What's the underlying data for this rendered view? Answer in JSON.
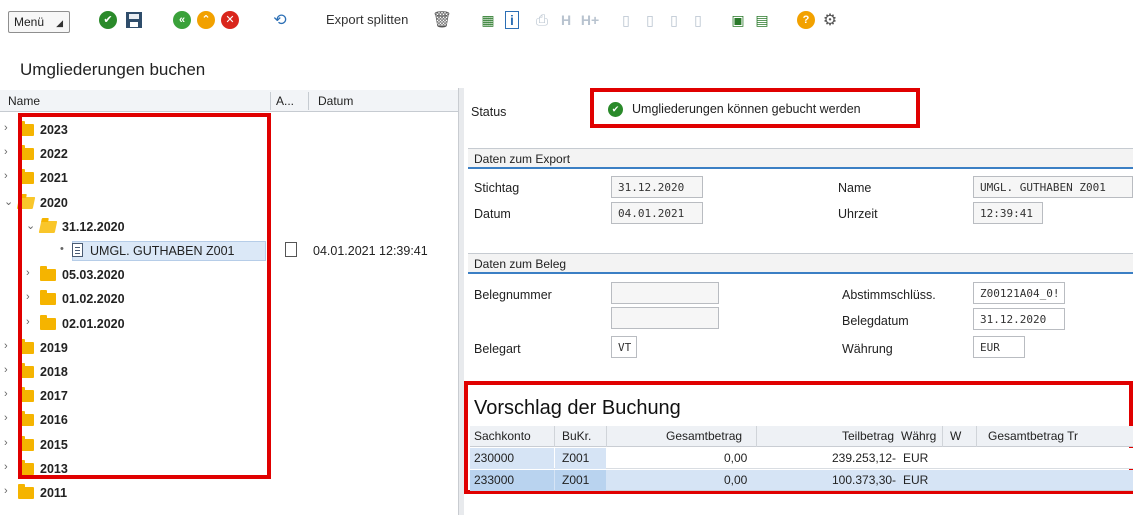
{
  "toolbar": {
    "menu_label": "Menü",
    "export_split_label": "Export splitten",
    "icons": [
      "check-icon",
      "save-icon",
      "back-icon",
      "up-icon",
      "cancel-icon",
      "refresh-icon",
      "delete-icon",
      "table-icon",
      "info-icon",
      "print-icon",
      "find-icon",
      "find-next-icon",
      "first-page-icon",
      "prev-page-icon",
      "next-page-icon",
      "last-page-icon",
      "window-icon",
      "layout-icon",
      "help-icon",
      "settings-icon"
    ]
  },
  "page": {
    "title": "Umgliederungen buchen"
  },
  "tree": {
    "columns": {
      "name": "Name",
      "a": "A...",
      "datum": "Datum"
    },
    "rows": [
      {
        "label": "2023",
        "level": 0,
        "type": "folder",
        "expanded": false
      },
      {
        "label": "2022",
        "level": 0,
        "type": "folder",
        "expanded": false
      },
      {
        "label": "2021",
        "level": 0,
        "type": "folder",
        "expanded": false
      },
      {
        "label": "2020",
        "level": 0,
        "type": "folder",
        "expanded": true
      },
      {
        "label": "31.12.2020",
        "level": 1,
        "type": "folder",
        "expanded": true
      },
      {
        "label": "UMGL. GUTHABEN Z001",
        "level": 2,
        "type": "doc",
        "selected": true,
        "date": "04.01.2021 12:39:41"
      },
      {
        "label": "05.03.2020",
        "level": 1,
        "type": "folder",
        "expanded": false
      },
      {
        "label": "01.02.2020",
        "level": 1,
        "type": "folder",
        "expanded": false
      },
      {
        "label": "02.01.2020",
        "level": 1,
        "type": "folder",
        "expanded": false
      },
      {
        "label": "2019",
        "level": 0,
        "type": "folder",
        "expanded": false
      },
      {
        "label": "2018",
        "level": 0,
        "type": "folder",
        "expanded": false
      },
      {
        "label": "2017",
        "level": 0,
        "type": "folder",
        "expanded": false
      },
      {
        "label": "2016",
        "level": 0,
        "type": "folder",
        "expanded": false
      },
      {
        "label": "2015",
        "level": 0,
        "type": "folder",
        "expanded": false
      },
      {
        "label": "2013",
        "level": 0,
        "type": "folder",
        "expanded": false
      },
      {
        "label": "2011",
        "level": 0,
        "type": "folder",
        "expanded": false
      }
    ]
  },
  "status": {
    "label": "Status",
    "text": "Umgliederungen können gebucht werden"
  },
  "export_group": {
    "title": "Daten zum Export",
    "stichtag_label": "Stichtag",
    "stichtag": "31.12.2020",
    "datum_label": "Datum",
    "datum": "04.01.2021",
    "name_label": "Name",
    "name": "UMGL. GUTHABEN Z001",
    "uhrzeit_label": "Uhrzeit",
    "uhrzeit": "12:39:41"
  },
  "beleg_group": {
    "title": "Daten zum Beleg",
    "belegnummer_label": "Belegnummer",
    "belegnummer": "",
    "belegart_label": "Belegart",
    "belegart": "VT",
    "abstimm_label": "Abstimmschlüss.",
    "abstimm": "Z00121A04_0!",
    "belegdatum_label": "Belegdatum",
    "belegdatum": "31.12.2020",
    "waehrung_label": "Währung",
    "waehrung": "EUR"
  },
  "proposal": {
    "title": "Vorschlag der Buchung",
    "columns": {
      "sachkonto": "Sachkonto",
      "bukr": "BuKr.",
      "gesamt": "Gesamtbetrag",
      "teil": "Teilbetrag",
      "waehrg": "Währg",
      "w": "W",
      "gesamt2": "Gesamtbetrag Tr"
    },
    "rows": [
      {
        "sachkonto": "230000",
        "bukr": "Z001",
        "gesamt": "0,00",
        "teil": "239.253,12-",
        "waehrg": "EUR"
      },
      {
        "sachkonto": "233000",
        "bukr": "Z001",
        "gesamt": "0,00",
        "teil": "100.373,30-",
        "waehrg": "EUR"
      }
    ]
  },
  "colors": {
    "accent": "#3b7fc4",
    "highlight": "#e00000",
    "success": "#2a8a2a"
  }
}
